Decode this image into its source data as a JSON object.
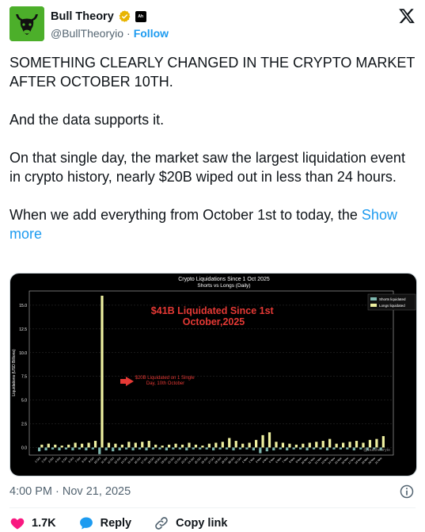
{
  "author": {
    "display_name": "Bull Theory",
    "handle": "@BullTheoryio",
    "follow_label": "Follow",
    "separator": "·",
    "affiliate_badge": "Ah",
    "avatar_icon": "bull-head-icon",
    "avatar_bg": "#4caf2a"
  },
  "tweet": {
    "paragraphs": [
      "SOMETHING CLEARLY CHANGED IN THE CRYPTO MARKET AFTER OCTOBER 10TH.",
      "And the data supports it.",
      "On that single day, the market saw the largest liquidation event in crypto history, nearly $20B wiped out in less than 24 hours.",
      "When we add everything from October 1st to today, the"
    ],
    "show_more": "Show more"
  },
  "footer": {
    "timestamp": "4:00 PM · Nov 21, 2025",
    "likes": "1.7K",
    "reply_label": "Reply",
    "copy_label": "Copy link"
  },
  "colors": {
    "accent": "#1d9bf0",
    "like": "#f91880",
    "shorts": "#7fb8b0",
    "longs": "#eef0a0",
    "annotation_red": "#e53935"
  },
  "chart_data": {
    "type": "bar",
    "title": "Crypto Liquidations Since 1 Oct 2025",
    "subtitle": "Shorts vs Longs (Daily)",
    "ylabel": "Liquidations (USD Billions)",
    "ylim": [
      -0.8,
      16.5
    ],
    "yticks": [
      0.0,
      2.5,
      5.0,
      7.5,
      10.0,
      12.5,
      15.0
    ],
    "legend_position": "top-right",
    "grid": true,
    "watermark": "@bulltheoryio",
    "annotations": {
      "headline": "$41B Liquidated Since 1st October,2025",
      "arrow_note": "$20B Liquidated on 1 Single Day, 10th October"
    },
    "categories": [
      "1 Oct",
      "2 Oct",
      "3 Oct",
      "4 Oct",
      "5 Oct",
      "6 Oct",
      "7 Oct",
      "8 Oct",
      "9 Oct",
      "10 Oct",
      "11 Oct",
      "12 Oct",
      "13 Oct",
      "14 Oct",
      "15 Oct",
      "16 Oct",
      "17 Oct",
      "18 Oct",
      "19 Oct",
      "20 Oct",
      "21 Oct",
      "22 Oct",
      "23 Oct",
      "24 Oct",
      "25 Oct",
      "26 Oct",
      "27 Oct",
      "28 Oct",
      "29 Oct",
      "30 Oct",
      "31 Oct",
      "1 Nov",
      "2 Nov",
      "3 Nov",
      "4 Nov",
      "5 Nov",
      "6 Nov",
      "7 Nov",
      "8 Nov",
      "9 Nov",
      "10 Nov",
      "11 Nov",
      "12 Nov",
      "13 Nov",
      "14 Nov",
      "15 Nov",
      "16 Nov",
      "17 Nov",
      "18 Nov",
      "19 Nov",
      "20 Nov",
      "21 Nov"
    ],
    "series": [
      {
        "name": "Shorts liquidated",
        "values": [
          -0.4,
          -0.3,
          -0.2,
          -0.3,
          -0.2,
          -0.3,
          -0.2,
          -0.3,
          -0.2,
          -0.7,
          -0.3,
          -0.4,
          -0.3,
          -0.2,
          -0.3,
          -0.2,
          -0.3,
          -0.2,
          -0.2,
          -0.3,
          -0.2,
          -0.2,
          -0.3,
          -0.2,
          -0.2,
          -0.2,
          -0.3,
          -0.2,
          -0.2,
          -0.3,
          -0.2,
          -0.2,
          -0.3,
          -0.6,
          -0.4,
          -0.3,
          -0.2,
          -0.3,
          -0.2,
          -0.2,
          -0.3,
          -0.2,
          -0.2,
          -0.3,
          -0.2,
          -0.2,
          -0.2,
          -0.3,
          -0.2,
          -0.3,
          -0.2,
          -0.3
        ]
      },
      {
        "name": "Longs liquidated",
        "values": [
          0.3,
          0.4,
          0.3,
          0.2,
          0.3,
          0.5,
          0.4,
          0.5,
          0.7,
          16.0,
          0.5,
          0.4,
          0.3,
          0.6,
          0.5,
          0.6,
          0.7,
          0.3,
          0.2,
          0.3,
          0.4,
          0.3,
          0.5,
          0.3,
          0.2,
          0.4,
          0.5,
          0.6,
          1.0,
          0.7,
          0.4,
          0.5,
          0.8,
          1.3,
          1.6,
          0.6,
          0.5,
          0.4,
          0.3,
          0.4,
          0.5,
          0.6,
          0.7,
          0.9,
          0.4,
          0.5,
          0.6,
          0.7,
          0.5,
          0.8,
          0.9,
          1.2
        ]
      }
    ]
  }
}
